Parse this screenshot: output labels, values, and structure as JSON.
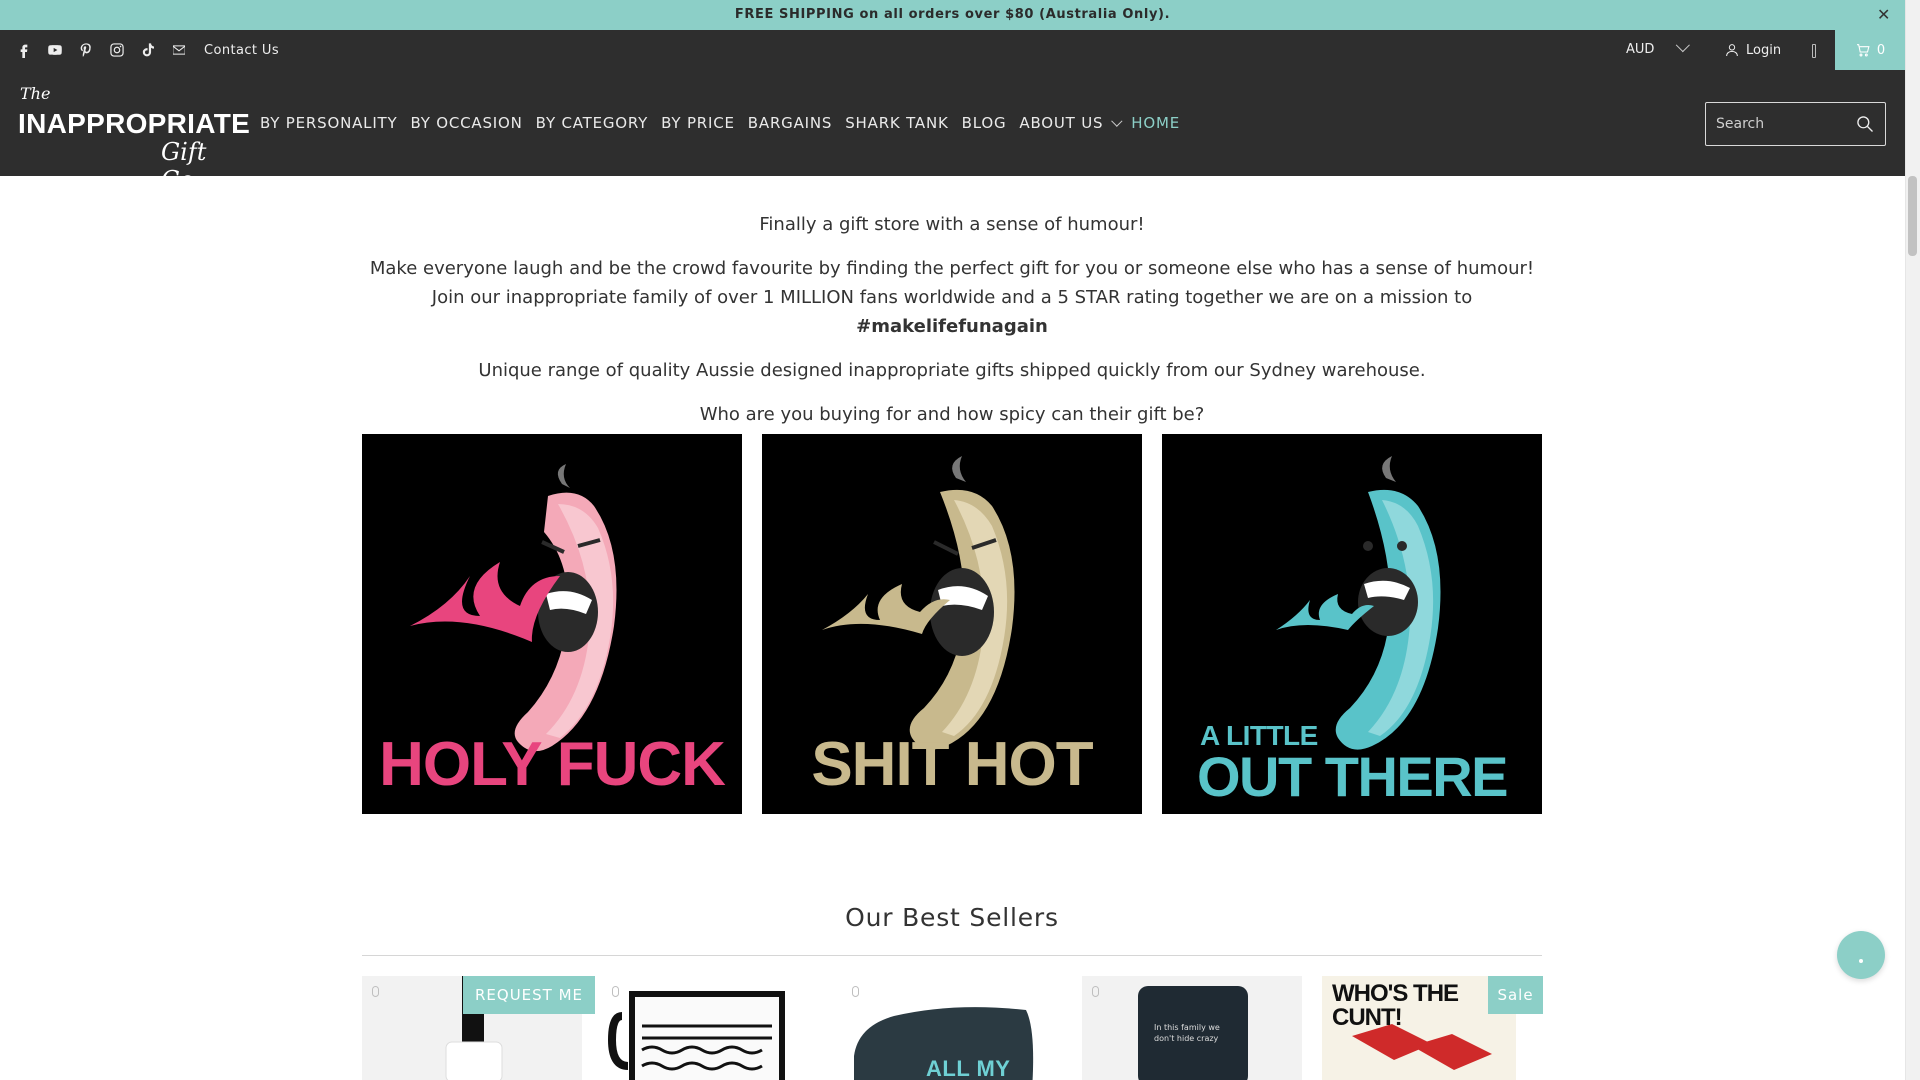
{
  "announcement": {
    "text": "FREE SHIPPING on all orders over $80 (Australia Only).",
    "close": "✕"
  },
  "topbar": {
    "social_icons": [
      "facebook-icon",
      "youtube-icon",
      "pinterest-icon",
      "instagram-icon",
      "tiktok-icon",
      "mail-icon"
    ],
    "contact_label": "Contact Us",
    "currency": "AUD",
    "login_label": "Login",
    "cart_count": "0"
  },
  "logo": {
    "the": "The",
    "main": "INAPPROPRIATE",
    "gift": "Gift Co"
  },
  "nav": {
    "items": [
      {
        "label": "BY PERSONALITY"
      },
      {
        "label": "BY OCCASION"
      },
      {
        "label": "BY CATEGORY"
      },
      {
        "label": "BY PRICE"
      },
      {
        "label": "BARGAINS"
      },
      {
        "label": "SHARK TANK"
      },
      {
        "label": "BLOG"
      },
      {
        "label": "ABOUT US"
      },
      {
        "label": "HOME"
      }
    ]
  },
  "search": {
    "placeholder": "Search"
  },
  "intro": {
    "line1": "Finally a gift store with a sense of humour!",
    "line2a": "Make everyone laugh and be the crowd favourite by finding the perfect gift for you or someone else who has a sense of humour!  Join our inappropriate family of over 1 MILLION fans worldwide and a 5 STAR rating together we are on a mission to ",
    "hashtag": "#makelifefunagain",
    "line3": "Unique range of quality Aussie designed inappropriate gifts shipped quickly from our Sydney warehouse.",
    "line4": "Who are you buying for and how spicy can their gift be?"
  },
  "tiles": [
    {
      "caption": "HOLY FUCK",
      "color": "#e8457e"
    },
    {
      "caption": "SHIT HOT",
      "color": "#c8b98d"
    },
    {
      "caption_small": "A LITTLE",
      "caption": "OUT THERE",
      "color": "#59c3c9"
    }
  ],
  "best_sellers": {
    "title": "Our Best Sellers",
    "badges": {
      "request": "REQUEST ME",
      "sale": "Sale"
    },
    "visible_product_text": {
      "bag": "ALL MY",
      "game": "WHO'S THE CUNT!",
      "cooler": "In this family we don't hide crazy"
    }
  },
  "colors": {
    "accent": "#8ccfc7",
    "header_bg": "#2e2e2e"
  }
}
